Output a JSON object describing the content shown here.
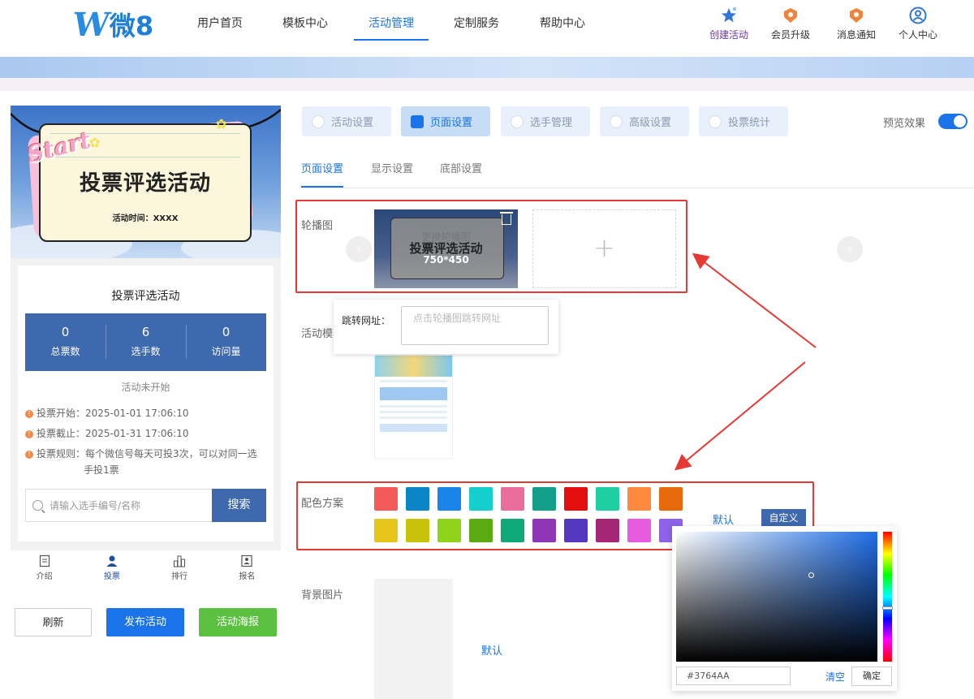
{
  "header": {
    "logo_text": "微8",
    "nav": [
      "用户首页",
      "模板中心",
      "活动管理",
      "定制服务",
      "帮助中心"
    ],
    "actions": [
      {
        "label": "创建活动",
        "icon": "star-icon"
      },
      {
        "label": "会员升级",
        "icon": "badge-icon"
      },
      {
        "label": "消息通知",
        "icon": "badge-icon"
      },
      {
        "label": "个人中心",
        "icon": "user-icon"
      }
    ]
  },
  "preview": {
    "cover_start": "Start",
    "cover_title": "投票评选活动",
    "cover_time": "活动时间：XXXX",
    "title": "投票评选活动",
    "stats": [
      {
        "num": "0",
        "label": "总票数"
      },
      {
        "num": "6",
        "label": "选手数"
      },
      {
        "num": "0",
        "label": "访问量"
      }
    ],
    "status": "活动未开始",
    "rules": [
      {
        "key": "投票开始：",
        "value": "2025-01-01 17:06:10"
      },
      {
        "key": "投票截止：",
        "value": "2025-01-31 17:06:10"
      },
      {
        "key": "投票规则：",
        "value": "每个微信号每天可投3次，可以对同一选手投1票"
      }
    ],
    "search_placeholder": "请输入选手编号/名称",
    "search_button": "搜索",
    "tabbar": [
      "介绍",
      "投票",
      "排行",
      "报名"
    ]
  },
  "bottom_buttons": {
    "refresh": "刷新",
    "publish": "发布活动",
    "poster": "活动海报"
  },
  "settings": {
    "tabs": [
      "活动设置",
      "页面设置",
      "选手管理",
      "高级设置",
      "投票统计"
    ],
    "preview_label": "预览效果",
    "subtabs": [
      "页面设置",
      "显示设置",
      "底部设置"
    ],
    "carousel_label": "轮播图",
    "carousel_overlay_replace": "更换轮播图",
    "carousel_overlay_size": "750*450",
    "add_symbol": "+",
    "url_label": "跳转网址：",
    "url_placeholder": "点击轮播图跳转网址",
    "template_label": "活动模",
    "color_label": "配色方案",
    "default_label": "默认",
    "custom_label": "自定义",
    "bg_label": "背景图片",
    "bg_default": "默认"
  },
  "swatches": {
    "row1": [
      "#f25a5a",
      "#0b85c6",
      "#1a84ea",
      "#15cfcf",
      "#ea6d9c",
      "#13a08a",
      "#e40e0e",
      "#1fcfa2",
      "#ff8a3d",
      "#e66a0c"
    ],
    "row2": [
      "#e8c51a",
      "#c8c20a",
      "#8fd31a",
      "#5aaa12",
      "#0fa878",
      "#8e36b6",
      "#5637bf",
      "#a52675",
      "#e65be0",
      "#8f62ea"
    ]
  },
  "picker": {
    "hex": "#3764AA",
    "clear": "清空",
    "confirm": "确定",
    "selected_color": "#3764aa"
  },
  "colors": {
    "accent": "#1a73e8",
    "theme": "#3e69ae",
    "highlight": "#e53935"
  }
}
